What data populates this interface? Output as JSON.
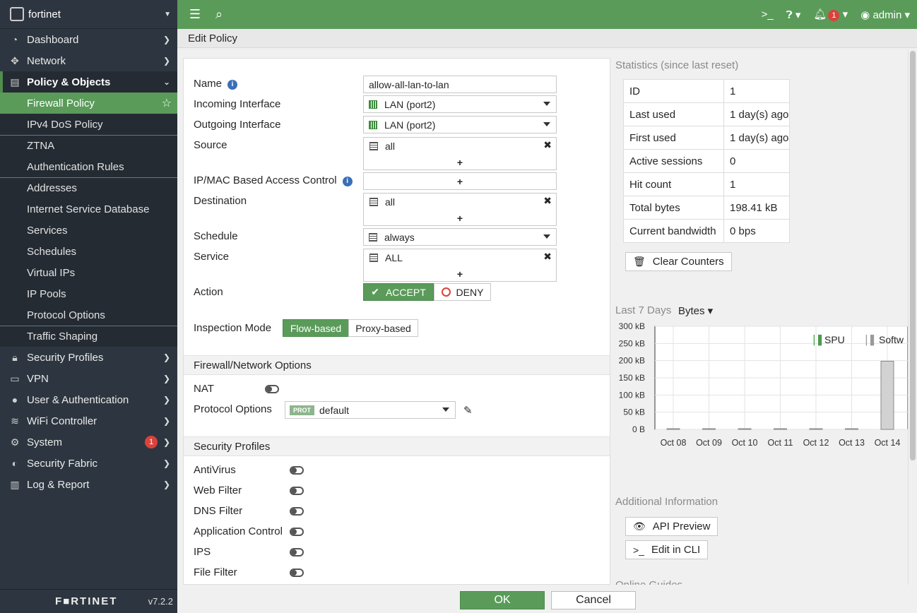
{
  "app": {
    "brand": "fortinet",
    "footer_logo": "F■RTINET",
    "version": "v7.2.2"
  },
  "sidebar": {
    "items": [
      {
        "label": "Dashboard",
        "icon": "dashboard-icon"
      },
      {
        "label": "Network",
        "icon": "network-icon"
      },
      {
        "label": "Policy & Objects",
        "icon": "policy-icon"
      },
      {
        "label": "Security Profiles",
        "icon": "lock-icon"
      },
      {
        "label": "VPN",
        "icon": "laptop-icon"
      },
      {
        "label": "User & Authentication",
        "icon": "user-icon"
      },
      {
        "label": "WiFi Controller",
        "icon": "wifi-icon"
      },
      {
        "label": "System",
        "icon": "gear-icon",
        "badge": "1"
      },
      {
        "label": "Security Fabric",
        "icon": "fabric-icon"
      },
      {
        "label": "Log & Report",
        "icon": "chart-icon"
      }
    ],
    "sub_items": [
      "Firewall Policy",
      "IPv4 DoS Policy",
      "ZTNA",
      "Authentication Rules",
      "Addresses",
      "Internet Service Database",
      "Services",
      "Schedules",
      "Virtual IPs",
      "IP Pools",
      "Protocol Options",
      "Traffic Shaping"
    ]
  },
  "topbar": {
    "notif_count": "1",
    "user": "admin"
  },
  "page": {
    "title": "Edit Policy"
  },
  "form": {
    "name_label": "Name",
    "name_value": "allow-all-lan-to-lan",
    "incoming_label": "Incoming Interface",
    "incoming_value": "LAN (port2)",
    "outgoing_label": "Outgoing Interface",
    "outgoing_value": "LAN (port2)",
    "source_label": "Source",
    "source_value": "all",
    "ipmac_label": "IP/MAC Based Access Control",
    "destination_label": "Destination",
    "destination_value": "all",
    "schedule_label": "Schedule",
    "schedule_value": "always",
    "service_label": "Service",
    "service_value": "ALL",
    "action_label": "Action",
    "accept": "ACCEPT",
    "deny": "DENY",
    "inspection_label": "Inspection Mode",
    "flow_based": "Flow-based",
    "proxy_based": "Proxy-based",
    "plus": "+"
  },
  "nat_section": {
    "title": "Firewall/Network Options",
    "nat_label": "NAT",
    "protocol_label": "Protocol Options",
    "prot_tag": "PROT",
    "protocol_value": "default"
  },
  "security_section": {
    "title": "Security Profiles",
    "items": [
      "AntiVirus",
      "Web Filter",
      "DNS Filter",
      "Application Control",
      "IPS",
      "File Filter"
    ]
  },
  "stats": {
    "title": "Statistics (since last reset)",
    "rows": [
      {
        "k": "ID",
        "v": "1"
      },
      {
        "k": "Last used",
        "v": "1 day(s) ago"
      },
      {
        "k": "First used",
        "v": "1 day(s) ago"
      },
      {
        "k": "Active sessions",
        "v": "0"
      },
      {
        "k": "Hit count",
        "v": "1"
      },
      {
        "k": "Total bytes",
        "v": "198.41 kB"
      },
      {
        "k": "Current bandwidth",
        "v": "0 bps"
      }
    ],
    "clear_counters": "Clear Counters"
  },
  "chart_header": {
    "period": "Last 7 Days",
    "metric": "Bytes"
  },
  "chart_data": {
    "type": "bar",
    "categories": [
      "Oct 08",
      "Oct 09",
      "Oct 10",
      "Oct 11",
      "Oct 12",
      "Oct 13",
      "Oct 14"
    ],
    "series": [
      {
        "name": "SPU",
        "values": [
          0,
          0,
          0,
          0,
          0,
          0,
          0
        ]
      },
      {
        "name": "Softw",
        "values": [
          0,
          0,
          0,
          0,
          0,
          0,
          198.41
        ]
      }
    ],
    "y_ticks": [
      "300 kB",
      "250 kB",
      "200 kB",
      "150 kB",
      "100 kB",
      "50 kB",
      "0 B"
    ],
    "ylim": [
      0,
      300
    ],
    "grid": true,
    "legend": "top-right"
  },
  "additional": {
    "title": "Additional Information",
    "api_preview": "API Preview",
    "edit_cli": "Edit in CLI",
    "online_guides": "Online Guides"
  },
  "footer": {
    "ok": "OK",
    "cancel": "Cancel"
  }
}
